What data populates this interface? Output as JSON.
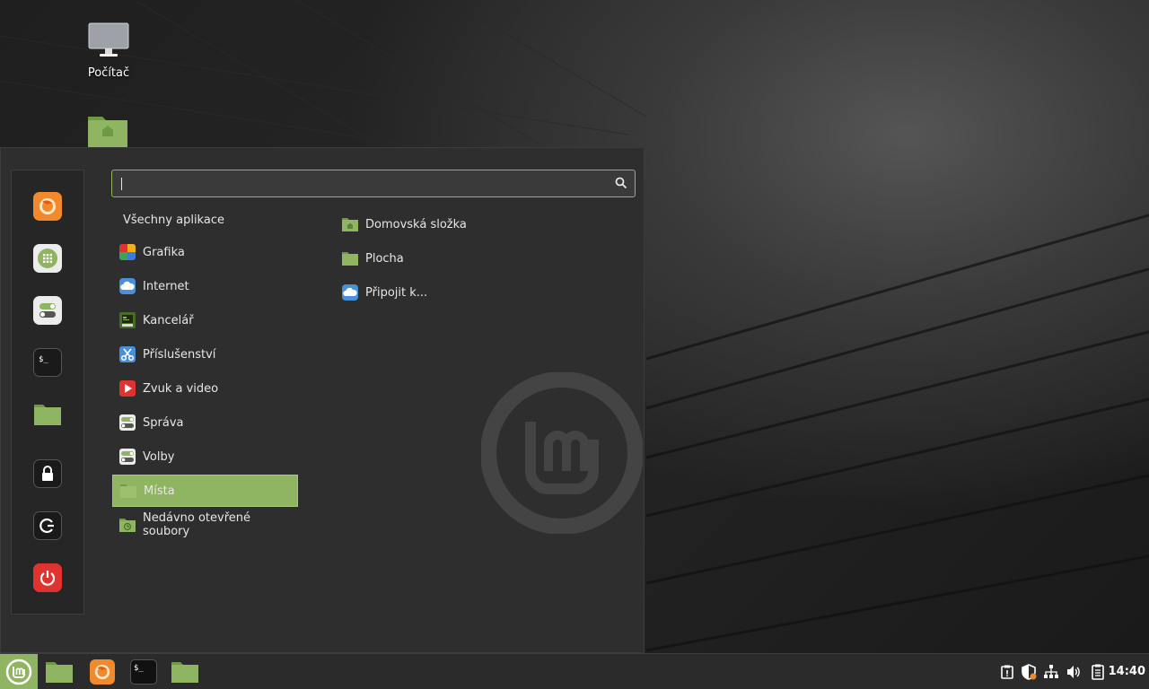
{
  "desktop": {
    "icons": [
      {
        "label": "Počítač",
        "icon": "computer-icon"
      },
      {
        "label": "",
        "icon": "home-folder-icon"
      }
    ]
  },
  "menu": {
    "search": {
      "value": "",
      "placeholder": "",
      "icon": "search-icon"
    },
    "all_apps_label": "Všechny aplikace",
    "favorites": [
      {
        "name": "firefox",
        "icon": "firefox-icon"
      },
      {
        "name": "software-manager",
        "icon": "app-grid-icon"
      },
      {
        "name": "settings",
        "icon": "toggles-icon"
      },
      {
        "name": "terminal",
        "icon": "terminal-icon"
      },
      {
        "name": "files",
        "icon": "folder-icon"
      },
      {
        "name": "lock",
        "icon": "lock-icon"
      },
      {
        "name": "logout",
        "icon": "logout-icon"
      },
      {
        "name": "shutdown",
        "icon": "power-icon"
      }
    ],
    "categories": [
      {
        "label": "Grafika",
        "icon": "graphics-icon"
      },
      {
        "label": "Internet",
        "icon": "cloud-icon"
      },
      {
        "label": "Kancelář",
        "icon": "office-icon"
      },
      {
        "label": "Příslušenství",
        "icon": "scissors-icon"
      },
      {
        "label": "Zvuk a video",
        "icon": "play-icon"
      },
      {
        "label": "Správa",
        "icon": "toggles-icon"
      },
      {
        "label": "Volby",
        "icon": "toggles-icon"
      },
      {
        "label": "Místa",
        "icon": "folder-icon",
        "selected": true
      },
      {
        "label": "Nedávno otevřené soubory",
        "icon": "recent-folder-icon"
      }
    ],
    "places": [
      {
        "label": "Domovská složka",
        "icon": "home-folder-icon"
      },
      {
        "label": "Plocha",
        "icon": "folder-icon"
      },
      {
        "label": "Připojit k...",
        "icon": "cloud-icon"
      }
    ]
  },
  "panel": {
    "launchers": [
      {
        "name": "files",
        "icon": "folder-icon"
      },
      {
        "name": "firefox",
        "icon": "firefox-icon"
      },
      {
        "name": "terminal",
        "icon": "terminal-icon"
      },
      {
        "name": "files-2",
        "icon": "folder-icon"
      }
    ],
    "tray": [
      {
        "name": "notifications",
        "icon": "notification-icon"
      },
      {
        "name": "update-manager",
        "icon": "shield-icon"
      },
      {
        "name": "network",
        "icon": "network-icon"
      },
      {
        "name": "volume",
        "icon": "volume-icon"
      },
      {
        "name": "clipboard",
        "icon": "clipboard-icon"
      }
    ],
    "clock": "14:40"
  },
  "colors": {
    "accent": "#8fb562",
    "menu_bg": "#2e2e2e",
    "panel_bg": "#2b2b2b",
    "power_red": "#e0322f",
    "firefox_orange": "#f08a2c"
  }
}
